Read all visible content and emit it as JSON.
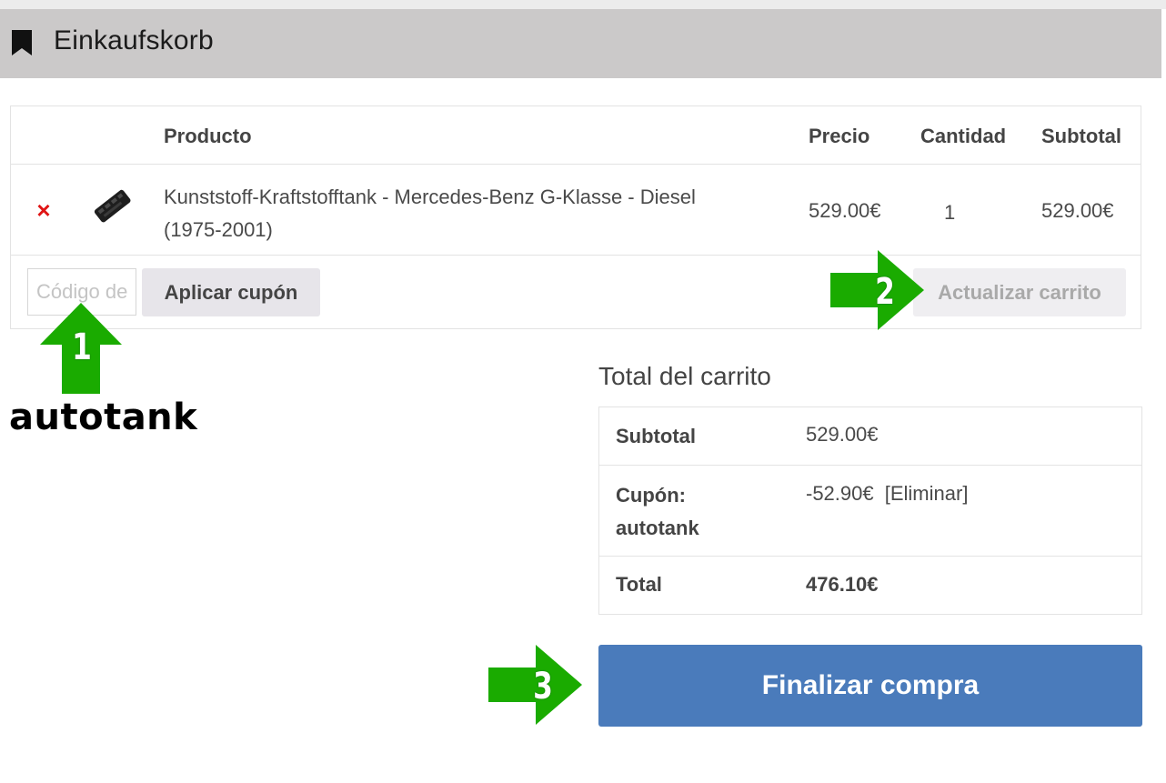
{
  "header": {
    "title": "Einkaufskorb",
    "icon": "bookmark-icon"
  },
  "cart": {
    "columns": {
      "product": "Producto",
      "price": "Precio",
      "quantity": "Cantidad",
      "subtotal": "Subtotal"
    },
    "items": [
      {
        "name_line1": "Kunststoff-Kraftstofftank - Mercedes-Benz G-Klasse - Diesel",
        "name_line2": "(1975-2001)",
        "price": "529.00€",
        "quantity": "1",
        "subtotal": "529.00€",
        "remove_icon": "×"
      }
    ],
    "coupon_placeholder": "Código de cupón",
    "apply_coupon_label": "Aplicar cupón",
    "update_cart_label": "Actualizar carrito"
  },
  "annotations": {
    "arrow1_number": "1",
    "arrow2_number": "2",
    "arrow3_number": "3",
    "coupon_code_text": "autotank",
    "arrow_color": "#1aab00"
  },
  "totals": {
    "title": "Total del carrito",
    "subtotal_label": "Subtotal",
    "subtotal_value": "529.00€",
    "coupon_label_line1": "Cupón:",
    "coupon_label_line2": "autotank",
    "coupon_value": "-52.90€",
    "coupon_remove_label": "[Eliminar]",
    "total_label": "Total",
    "total_value": "476.10€"
  },
  "checkout": {
    "label": "Finalizar compra",
    "color": "#4a7bbb"
  }
}
